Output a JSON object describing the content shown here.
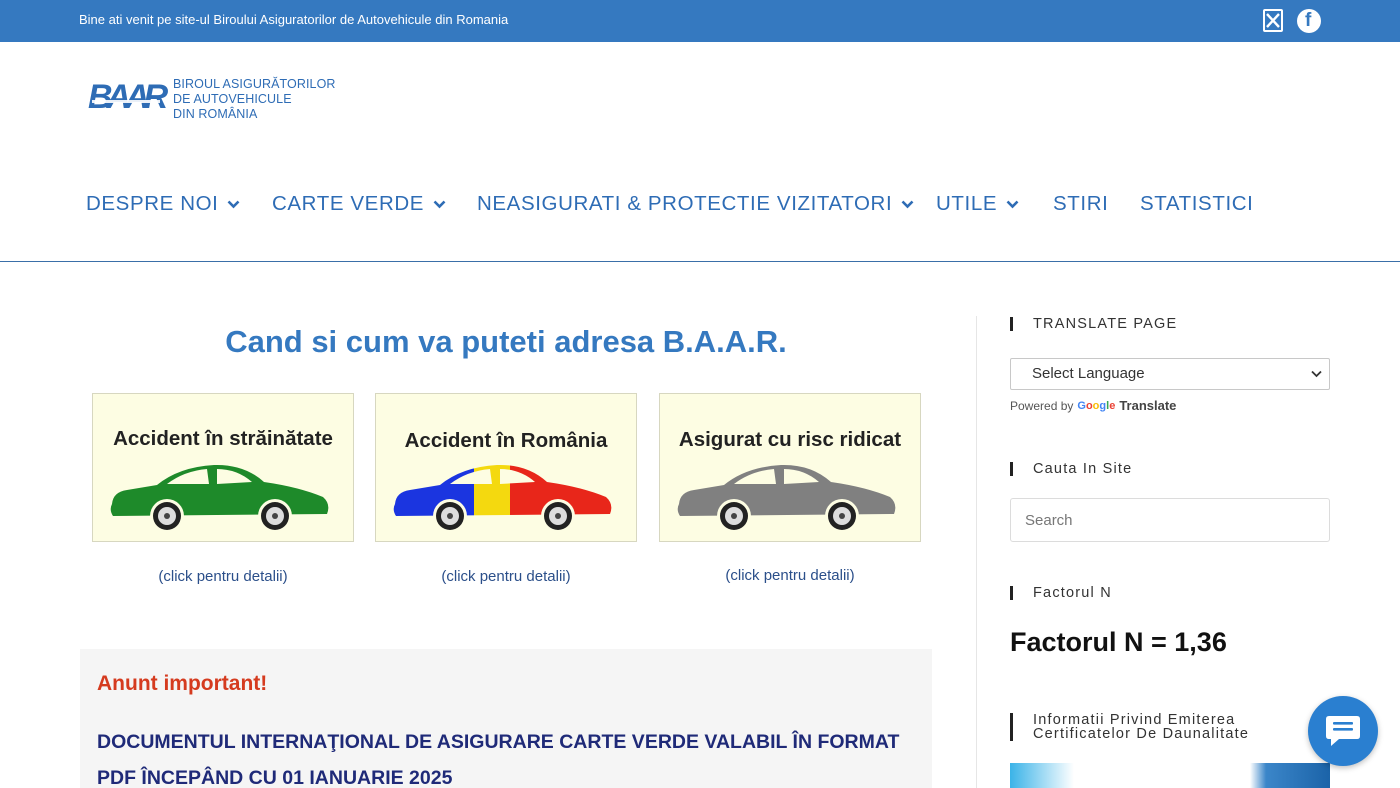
{
  "topbar": {
    "welcome": "Bine ati venit pe site-ul Biroului Asiguratorilor de Autovehicule din Romania",
    "social": [
      "x-icon",
      "facebook-icon"
    ]
  },
  "logo": {
    "mark": "BAAR",
    "line1": "BIROUL ASIGURĂTORILOR",
    "line2": "DE AUTOVEHICULE",
    "line3": "DIN ROMÂNIA"
  },
  "nav": {
    "items": [
      {
        "label": "DESPRE NOI",
        "has_dropdown": true
      },
      {
        "label": "CARTE VERDE",
        "has_dropdown": true
      },
      {
        "label": "NEASIGURATI & PROTECTIE VIZITATORI",
        "has_dropdown": true
      },
      {
        "label": "UTILE",
        "has_dropdown": true
      },
      {
        "label": "STIRI",
        "has_dropdown": false
      },
      {
        "label": "STATISTICI",
        "has_dropdown": false
      }
    ]
  },
  "main": {
    "title": "Cand si cum va puteti adresa B.A.A.R.",
    "cards": [
      {
        "title": "Accident în străinătate",
        "link": "(click pentru detalii)",
        "car_color": "green"
      },
      {
        "title": "Accident în România",
        "link": "(click pentru detalii)",
        "car_color": "tricolor"
      },
      {
        "title": "Asigurat cu risc ridicat",
        "link": "(click pentru detalii)",
        "car_color": "gray"
      }
    ],
    "notice": {
      "title": "Anunt important!",
      "body": "DOCUMENTUL INTERNAŢIONAL DE ASIGURARE CARTE VERDE VALABIL ÎN FORMAT PDF ÎNCEPÂND CU 01 IANUARIE 2025"
    }
  },
  "sidebar": {
    "translate_title": "TRANSLATE PAGE",
    "select_value": "Select Language",
    "powered_by": "Powered by",
    "google": "Google",
    "translate": "Translate",
    "search_title": "Cauta In Site",
    "search_placeholder": "Search",
    "factor_title": "Factorul N",
    "factor_value": "Factorul N = 1,36",
    "info_title": "Informatii Privind Emiterea Certificatelor De Daunalitate"
  },
  "colors": {
    "topbar": "#3579c0",
    "nav_text": "#2e6cb5",
    "notice_title": "#d53b1f",
    "notice_body": "#1f2a78",
    "chat": "#2a7fd0"
  }
}
